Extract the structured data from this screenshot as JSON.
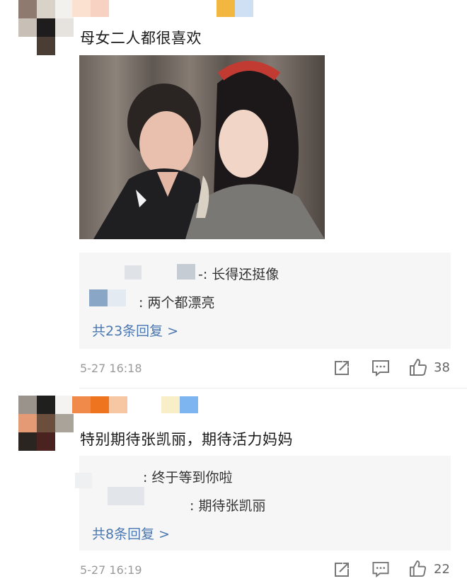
{
  "comments": [
    {
      "text": "母女二人都很喜欢",
      "replies": [
        {
          "text": "-: 长得还挺像"
        },
        {
          "text": ": 两个都漂亮"
        }
      ],
      "more_replies": "共23条回复 >",
      "time": "5-27 16:18",
      "likes": "38"
    },
    {
      "text": "特别期待张凯丽，期待活力妈妈",
      "replies": [
        {
          "text": ": 终于等到你啦"
        },
        {
          "text": ": 期待张凯丽"
        }
      ],
      "more_replies": "共8条回复 >",
      "time": "5-27 16:19",
      "likes": "22"
    }
  ],
  "icons": {
    "share": "share-icon",
    "comment": "comment-icon",
    "like": "thumbs-up-icon"
  },
  "colors": {
    "link": "#4a77b0",
    "reply_bg": "#f6f6f6",
    "meta": "#9a9a9a"
  }
}
